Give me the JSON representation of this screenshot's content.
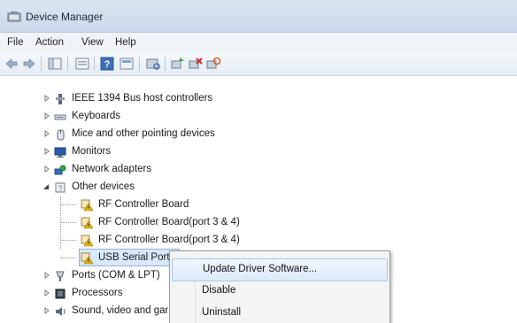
{
  "window": {
    "title": "Device Manager"
  },
  "menu": {
    "items": [
      "File",
      "Action",
      "View",
      "Help"
    ]
  },
  "toolbar": {
    "buttons": [
      "back-arrow-icon",
      "forward-arrow-icon",
      "console-tree-icon",
      "properties-icon",
      "help-icon",
      "show-hidden-icon",
      "scan-hardware-icon",
      "update-driver-icon",
      "uninstall-icon",
      "disable-icon"
    ]
  },
  "tree": {
    "items": [
      {
        "label": "IEEE 1394 Bus host controllers",
        "icon": "bus-controller-icon",
        "expanded": false
      },
      {
        "label": "Keyboards",
        "icon": "keyboard-icon",
        "expanded": false
      },
      {
        "label": "Mice and other pointing devices",
        "icon": "mouse-icon",
        "expanded": false
      },
      {
        "label": "Monitors",
        "icon": "monitor-icon",
        "expanded": false
      },
      {
        "label": "Network adapters",
        "icon": "network-adapter-icon",
        "expanded": false
      },
      {
        "label": "Other devices",
        "icon": "unknown-device-icon",
        "expanded": true
      },
      {
        "label": "RF Controller Board",
        "icon": "warning-device-icon",
        "child": true
      },
      {
        "label": "RF Controller Board(port 3 & 4)",
        "icon": "warning-device-icon",
        "child": true
      },
      {
        "label": "RF Controller Board(port 3 & 4)",
        "icon": "warning-device-icon",
        "child": true
      },
      {
        "label": "USB Serial Port",
        "icon": "warning-device-icon",
        "child": true,
        "selected": true
      },
      {
        "label": "Ports (COM & LPT)",
        "icon": "port-icon",
        "expanded": false
      },
      {
        "label": "Processors",
        "icon": "processor-icon",
        "expanded": false
      },
      {
        "label": "Sound, video and game controllers",
        "icon": "sound-icon",
        "expanded": false
      }
    ]
  },
  "context_menu": {
    "items": [
      {
        "label": "Update Driver Software...",
        "highlighted": true
      },
      {
        "label": "Disable"
      },
      {
        "label": "Uninstall"
      }
    ]
  },
  "colors": {
    "selection": "#d9e8fb",
    "warning": "#e8b100"
  }
}
